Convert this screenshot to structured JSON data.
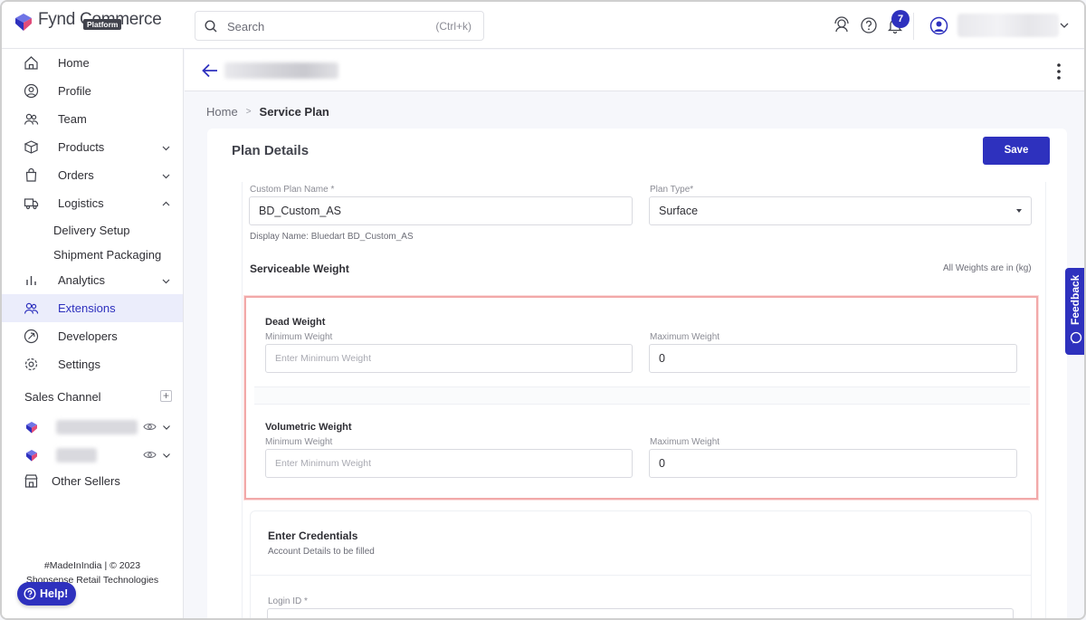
{
  "brand": {
    "name": "Fynd Commerce",
    "sub": "Platform"
  },
  "search": {
    "placeholder": "Search",
    "shortcut": "(Ctrl+k)"
  },
  "notifications": {
    "count": "7"
  },
  "sidebar": {
    "items": [
      {
        "label": "Home",
        "icon": "home-icon"
      },
      {
        "label": "Profile",
        "icon": "user-circle-icon"
      },
      {
        "label": "Team",
        "icon": "team-icon"
      },
      {
        "label": "Products",
        "icon": "box-icon"
      },
      {
        "label": "Orders",
        "icon": "bag-icon"
      },
      {
        "label": "Logistics",
        "icon": "truck-icon"
      },
      {
        "label": "Analytics",
        "icon": "bar-chart-icon"
      },
      {
        "label": "Extensions",
        "icon": "extensions-icon"
      },
      {
        "label": "Developers",
        "icon": "developer-icon"
      },
      {
        "label": "Settings",
        "icon": "gear-icon"
      }
    ],
    "logistics_sub": [
      "Delivery Setup",
      "Shipment Packaging"
    ],
    "sales_channel_label": "Sales Channel",
    "other_sellers": "Other Sellers",
    "footer_line1": "#MadeInIndia | © 2023",
    "footer_line2": "Shopsense Retail Technologies",
    "help": "Help!"
  },
  "breadcrumb": {
    "home": "Home",
    "sep": ">",
    "current": "Service Plan"
  },
  "plan": {
    "title": "Plan Details",
    "save": "Save",
    "custom_name_label": "Custom Plan Name *",
    "custom_name_value": "BD_Custom_AS",
    "display_name": "Display Name: Bluedart BD_Custom_AS",
    "plan_type_label": "Plan Type*",
    "plan_type_value": "Surface",
    "serviceable_weight": "Serviceable Weight",
    "weights_unit_note": "All Weights are in (kg)"
  },
  "dead_weight": {
    "title": "Dead Weight",
    "min_label": "Minimum Weight",
    "min_placeholder": "Enter Minimum Weight",
    "max_label": "Maximum Weight",
    "max_value": "0"
  },
  "volumetric_weight": {
    "title": "Volumetric Weight",
    "min_label": "Minimum Weight",
    "min_placeholder": "Enter Minimum Weight",
    "max_label": "Maximum Weight",
    "max_value": "0"
  },
  "credentials": {
    "title": "Enter Credentials",
    "subtitle": "Account Details to be filled",
    "login_label": "Login ID *"
  },
  "feedback": "Feedback",
  "colors": {
    "primary": "#2e31be",
    "highlight": "#f2a9a9"
  }
}
